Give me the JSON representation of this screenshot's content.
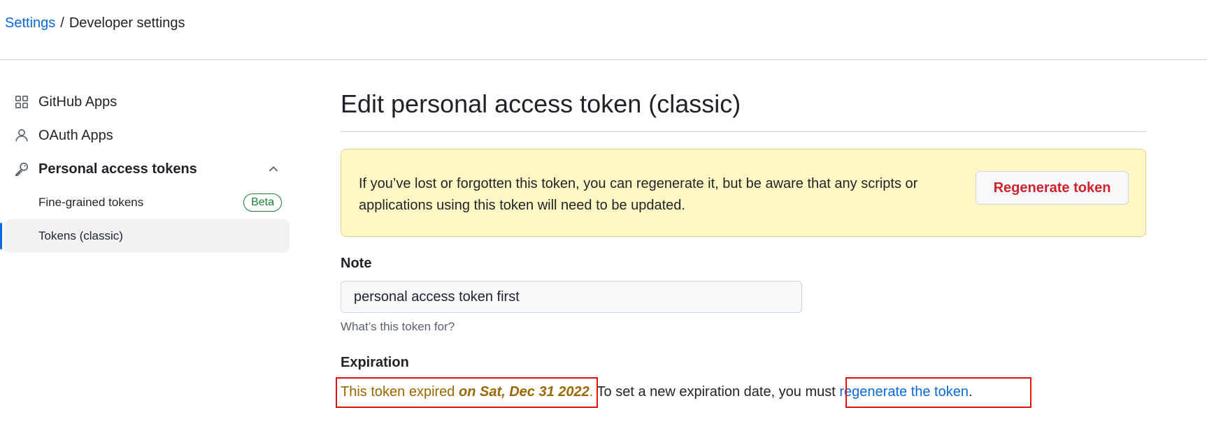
{
  "breadcrumb": {
    "root": "Settings",
    "separator": "/",
    "current": "Developer settings"
  },
  "sidebar": {
    "items": [
      {
        "label": "GitHub Apps",
        "icon": "apps-grid-icon"
      },
      {
        "label": "OAuth Apps",
        "icon": "person-icon"
      },
      {
        "label": "Personal access tokens",
        "icon": "key-icon",
        "expanded": true
      }
    ],
    "sub_items": [
      {
        "label": "Fine-grained tokens",
        "badge": "Beta"
      },
      {
        "label": "Tokens (classic)",
        "active": true
      }
    ]
  },
  "main": {
    "title": "Edit personal access token (classic)",
    "flash": {
      "message": "If you’ve lost or forgotten this token, you can regenerate it, but be aware that any scripts or applications using this token will need to be updated.",
      "button_label": "Regenerate token"
    },
    "note": {
      "label": "Note",
      "value": "personal access token first",
      "hint": "What’s this token for?"
    },
    "expiration": {
      "label": "Expiration",
      "warn_prefix": "This token expired ",
      "date": "on Sat, Dec 31 2022",
      "period": ".",
      "middle": " To set a new expiration date, you must ",
      "link": "regenerate the token",
      "suffix": "."
    }
  },
  "colors": {
    "link": "#0969da",
    "danger": "#cf222e",
    "success": "#1a7f37",
    "attention": "#9a6700",
    "flash_bg": "#fff8c5",
    "highlight_box": "#e01010"
  }
}
